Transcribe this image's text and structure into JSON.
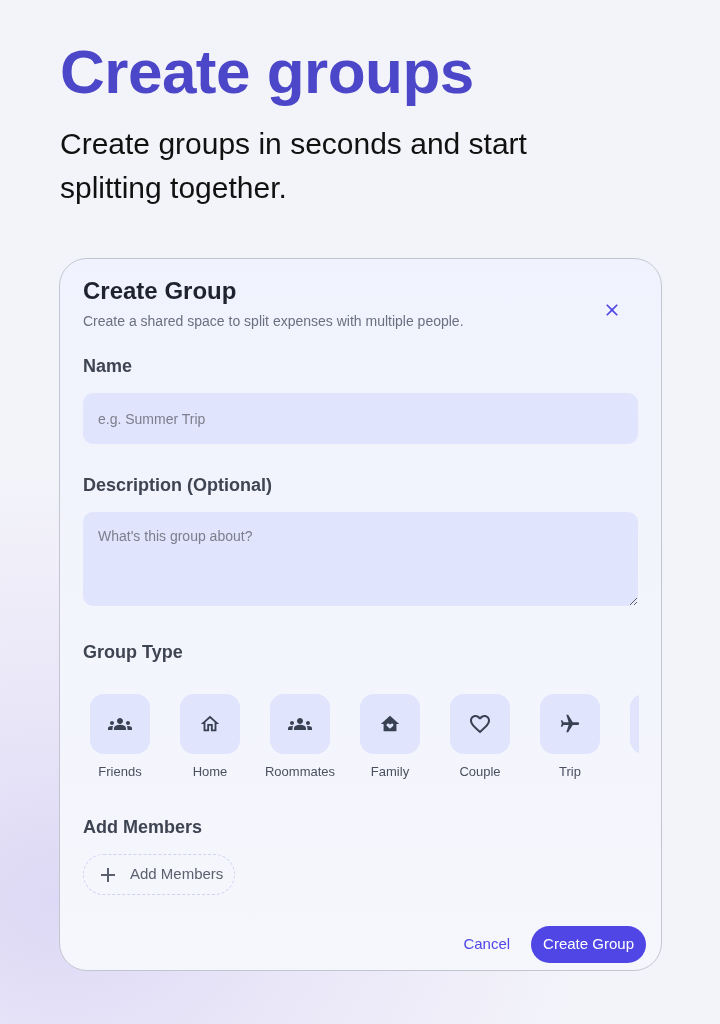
{
  "hero": {
    "title": "Create groups",
    "subtitle": "Create groups in seconds and start splitting together."
  },
  "dialog": {
    "title": "Create Group",
    "description": "Create a shared space to split expenses with multiple people.",
    "fields": [
      {
        "kind": "input",
        "label": "Name",
        "placeholder": "e.g. Summer Trip"
      },
      {
        "kind": "textarea",
        "label": "Description (Optional)",
        "placeholder": "What's this group about?"
      }
    ],
    "group_type": {
      "label": "Group Type",
      "options": [
        {
          "label": "Friends"
        },
        {
          "label": "Home"
        },
        {
          "label": "Roommates"
        },
        {
          "label": "Family"
        },
        {
          "label": "Couple"
        },
        {
          "label": "Trip"
        }
      ]
    },
    "members": {
      "label": "Add Members",
      "button": "Add Members"
    },
    "actions": {
      "cancel": "Cancel",
      "confirm": "Create Group"
    }
  }
}
